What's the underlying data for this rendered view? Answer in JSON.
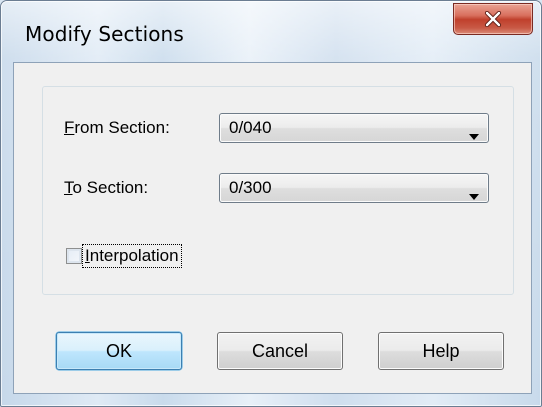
{
  "window": {
    "title": "Modify Sections",
    "close_icon": "close-icon"
  },
  "form": {
    "from_section": {
      "label_mnemonic": "F",
      "label_rest": "rom Section:",
      "value": "0/040"
    },
    "to_section": {
      "label_mnemonic": "T",
      "label_rest": "o Section:",
      "value": "0/300"
    },
    "interpolation": {
      "label_mnemonic": "I",
      "label_rest": "nterpolation",
      "checked": false
    }
  },
  "buttons": {
    "ok": "OK",
    "cancel": "Cancel",
    "help": "Help"
  },
  "colors": {
    "close_button": "#c7432f",
    "default_button_border": "#3c7fb1",
    "client_background": "#f0f0f0"
  }
}
